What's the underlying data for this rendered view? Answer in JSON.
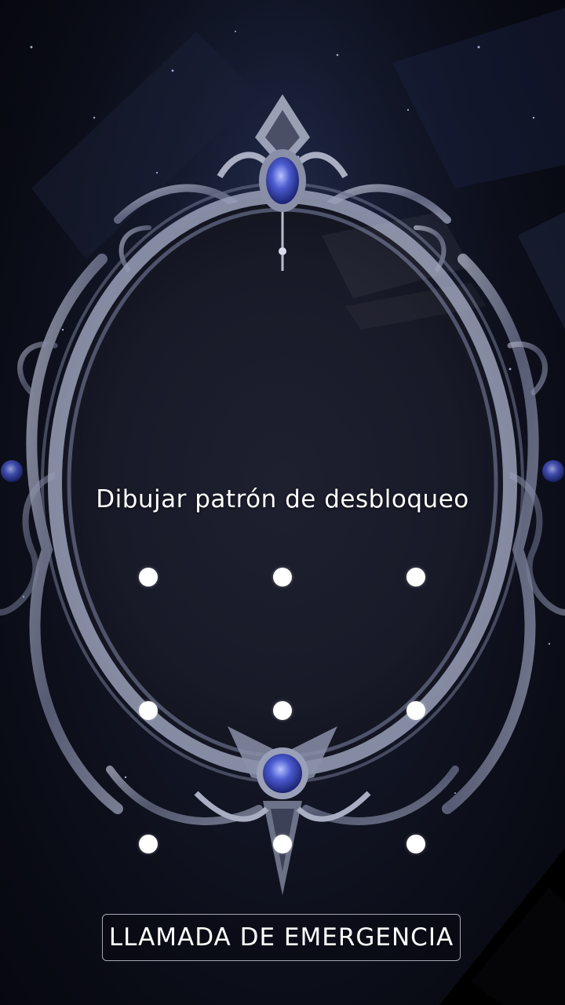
{
  "lockscreen": {
    "prompt": "Dibujar patrón de desbloqueo",
    "pattern_dots": [
      "dot-1",
      "dot-2",
      "dot-3",
      "dot-4",
      "dot-5",
      "dot-6",
      "dot-7",
      "dot-8",
      "dot-9"
    ],
    "emergency_label": "LLAMADA DE EMERGENCIA"
  },
  "wallpaper": {
    "subject": "ornate-mirror-frame",
    "colors": {
      "background": "#0b0d18",
      "frame": "#8a8fa8",
      "gem": "#3a4bb0",
      "mirror": "#1a1c2b"
    }
  }
}
